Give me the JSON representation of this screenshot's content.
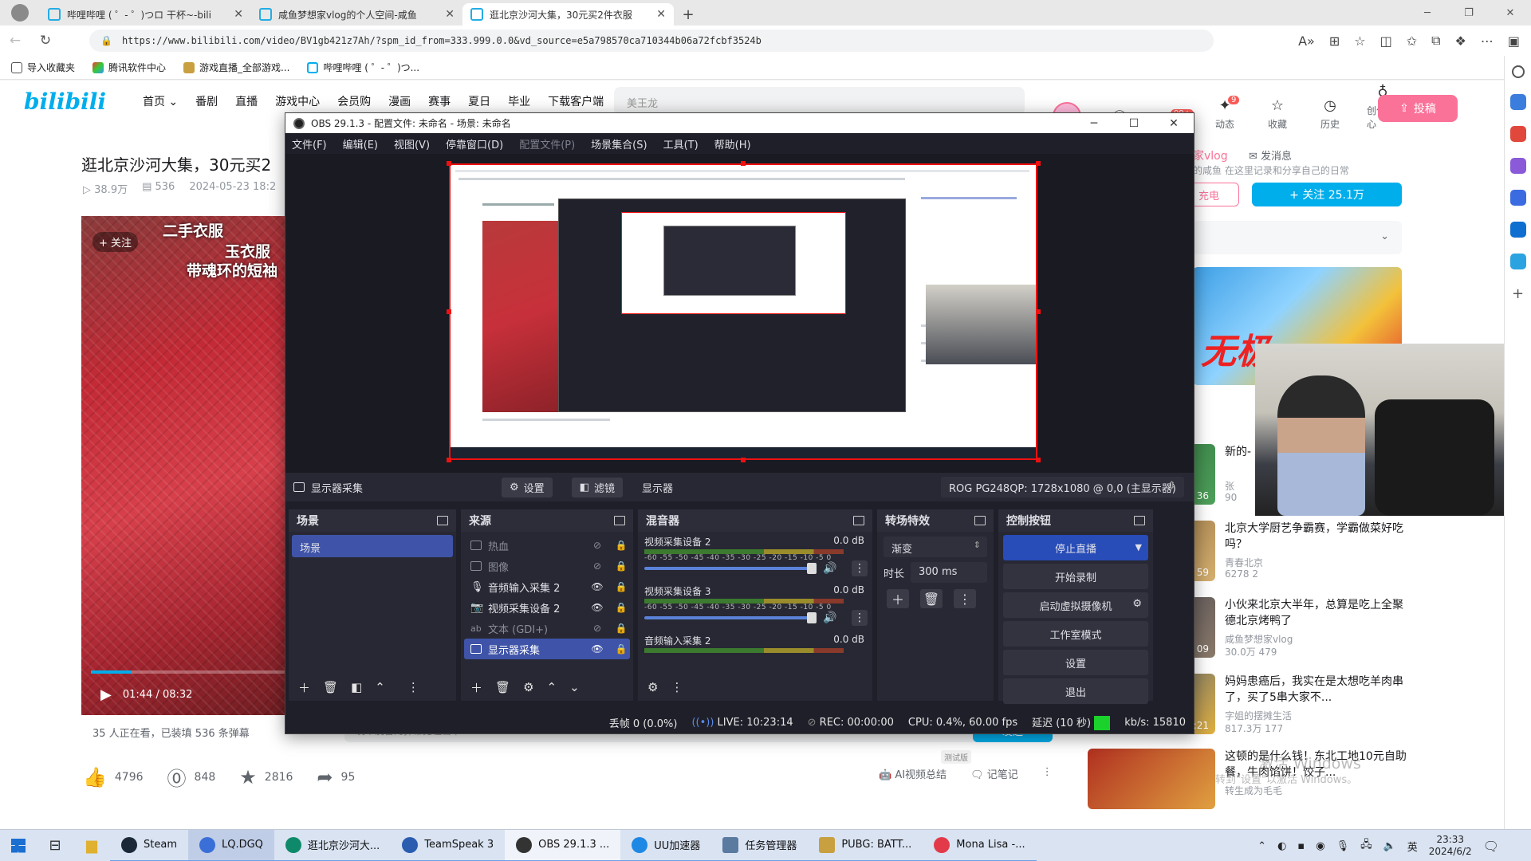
{
  "browser": {
    "tabs": [
      {
        "title": "哔哩哔哩 ( ゜- ゜)つロ 干杯~-bili",
        "active": false
      },
      {
        "title": "咸鱼梦想家vlog的个人空间-咸鱼",
        "active": false
      },
      {
        "title": "逛北京沙河大集，30元买2件衣服",
        "active": true
      }
    ],
    "url": "https://www.bilibili.com/video/BV1gb421z7Ah/?spm_id_from=333.999.0.0&vd_source=e5a798570ca710344b06a72fcbf3524b",
    "favorites": [
      "导入收藏夹",
      "腾讯软件中心",
      "游戏直播_全部游戏...",
      "哔哩哔哩 ( ゜- ゜)つ..."
    ]
  },
  "bili": {
    "logo": "bilibili",
    "nav": [
      "首页 ⌄",
      "番剧",
      "直播",
      "游戏中心",
      "会员购",
      "漫画",
      "赛事",
      "夏日",
      "毕业",
      "下载客户端"
    ],
    "search_placeholder": "美王龙",
    "right_items": [
      "",
      "",
      "",
      "动态",
      "收藏",
      "历史",
      "创作中心"
    ],
    "badge_msg": "99+",
    "badge_dyn": "9",
    "upload": "投稿",
    "video_title": "逛北京沙河大集，30元买2",
    "views": "38.9万",
    "danmaku": "536",
    "date": "2024-05-23 18:2",
    "follow_chip": "+ 关注",
    "caption1": "二手衣服",
    "caption2": "玉衣服",
    "caption3": "带魂环的短袖",
    "time": "01:44 / 08:32",
    "progress": 0.204,
    "viewers": "35 人正在看，已装填 536 条弹幕",
    "dm_placeholder": "发个友善的弹幕见证当下",
    "send": "发送",
    "likes": "4796",
    "coins": "848",
    "favs": "2816",
    "shares": "95",
    "ai_summary": "AI视频总结",
    "notes": "记笔记",
    "test_tag": "测试版",
    "up_name": "家vlog",
    "up_send": "发消息",
    "up_desc": "的咸鱼 在这里记录和分享自己的日常",
    "charge": "充电",
    "follow": "+ 关注 25.1万",
    "recs": [
      {
        "title": "新的-",
        "up": "张",
        "stat": "90",
        "dur": "36"
      },
      {
        "title": "北京大学厨艺争霸赛，学霸做菜好吃吗？",
        "up": "青春北京",
        "stat": "6278   2",
        "dur": "59"
      },
      {
        "title": "小伙来北京大半年，总算是吃上全聚德北京烤鸭了",
        "up": "咸鱼梦想家vlog",
        "stat": "30.0万   479",
        "dur": "09"
      },
      {
        "title": "妈妈患癌后，我实在是太想吃羊肉串了，买了5串大家不...",
        "up": "字姐的摆摊生活",
        "stat": "817.3万   177",
        "dur": "02:21"
      },
      {
        "title": "这顿的是什么钱！东北工地10元自助餐，牛肉馅饼！饺子...",
        "up": "转生成为毛毛",
        "stat": "",
        "dur": ""
      }
    ],
    "watermark1": "激活 Windows",
    "watermark2": "转到\"设置\"以激活 Windows。"
  },
  "obs": {
    "title": "OBS 29.1.3 - 配置文件: 未命名 - 场景: 未命名",
    "menu": [
      "文件(F)",
      "编辑(E)",
      "视图(V)",
      "停靠窗口(D)",
      "配置文件(P)",
      "场景集合(S)",
      "工具(T)",
      "帮助(H)"
    ],
    "source_label": "显示器采集",
    "settings_btn": "设置",
    "filters_btn": "滤镜",
    "display_label": "显示器",
    "display_value": "ROG PG248QP: 1728x1080 @ 0,0 (主显示器)",
    "docks": {
      "scenes": "场景",
      "sources": "来源",
      "mixer": "混音器",
      "transitions": "转场特效",
      "controls": "控制按钮"
    },
    "scenes": [
      "场景"
    ],
    "sources": [
      {
        "name": "热血",
        "visible": false,
        "selected": false
      },
      {
        "name": "图像",
        "visible": false,
        "selected": false
      },
      {
        "name": "音频输入采集 2",
        "visible": true,
        "selected": false
      },
      {
        "name": "视频采集设备 2",
        "visible": true,
        "selected": false
      },
      {
        "name": "文本 (GDI+)",
        "visible": false,
        "selected": false
      },
      {
        "name": "显示器采集",
        "visible": true,
        "selected": true
      }
    ],
    "mixer": [
      {
        "name": "视频采集设备 2",
        "db": "0.0 dB"
      },
      {
        "name": "视频采集设备 3",
        "db": "0.0 dB"
      },
      {
        "name": "音频输入采集 2",
        "db": "0.0 dB"
      }
    ],
    "mixer_ticks": "-60 -55 -50 -45 -40 -35 -30 -25 -20 -15 -10 -5 0",
    "transition": "渐变",
    "duration_label": "时长",
    "duration": "300 ms",
    "controls": [
      "停止直播",
      "开始录制",
      "启动虚拟摄像机",
      "工作室模式",
      "设置",
      "退出"
    ],
    "status": {
      "dropped": "丢帧 0 (0.0%)",
      "live": "LIVE: 10:23:14",
      "rec": "REC: 00:00:00",
      "cpu": "CPU: 0.4%, 60.00 fps",
      "delay": "延迟 (10 秒)",
      "kbs": "kb/s: 15810"
    }
  },
  "taskbar": {
    "apps": [
      {
        "label": "Steam",
        "color": "#1b2838"
      },
      {
        "label": "LQ.DGQ",
        "color": "#3a6fd8"
      },
      {
        "label": "逛北京沙河大...",
        "color": "#0e8a6a"
      },
      {
        "label": "TeamSpeak 3",
        "color": "#2a5db0"
      },
      {
        "label": "OBS 29.1.3 ...",
        "color": "#333333"
      },
      {
        "label": "UU加速器",
        "color": "#1e88e5"
      },
      {
        "label": "任务管理器",
        "color": "#5a7aa0"
      },
      {
        "label": "PUBG: BATT...",
        "color": "#c8a040"
      },
      {
        "label": "Mona Lisa -...",
        "color": "#e33a4a"
      }
    ],
    "lang": "英",
    "time": "23:33",
    "date": "2024/6/2"
  },
  "colors": {
    "bili_blue": "#00aeec",
    "bili_pink": "#fb7299",
    "obs_bg": "#1e1f29",
    "obs_panel": "#272833",
    "obs_selected": "#3f54a8"
  }
}
